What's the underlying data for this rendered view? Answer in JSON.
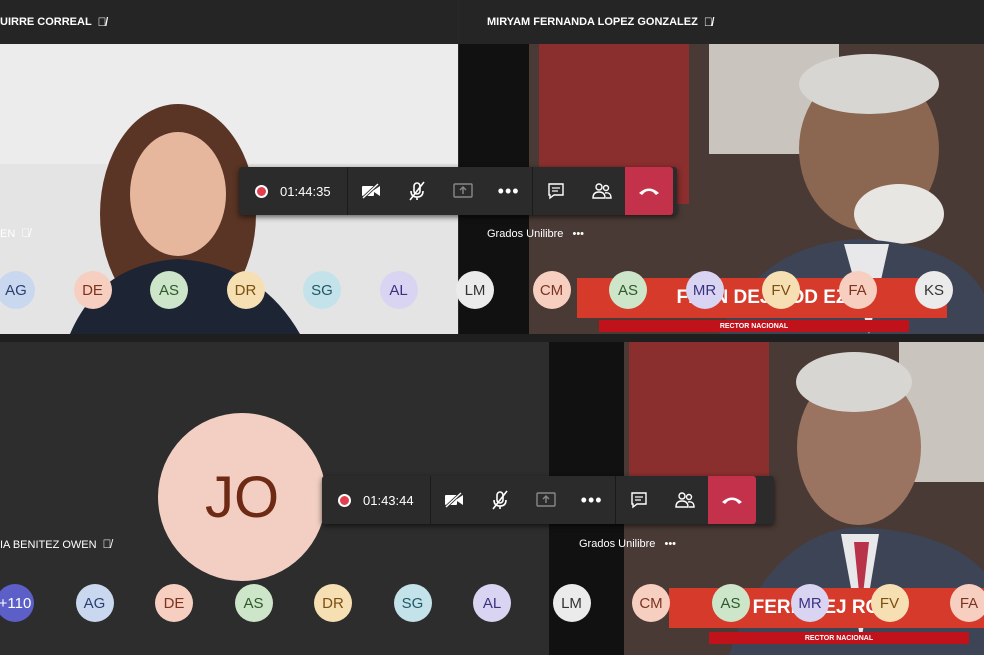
{
  "top": {
    "left_name": "UIRRE CORREAL",
    "right_name": "MIRYAM FERNANDA LOPEZ GONZALEZ",
    "partial_name": "EN",
    "stream_label": "Grados Unilibre",
    "stream_dots": "•••",
    "timer": "01:44:35",
    "banner_text": "FERN DEJ ROD EZ",
    "banner_sub": "RECTOR NACIONAL",
    "avatars": [
      {
        "initials": "AG",
        "color": "c1"
      },
      {
        "initials": "DE",
        "color": "c2"
      },
      {
        "initials": "AS",
        "color": "c3"
      },
      {
        "initials": "DR",
        "color": "c4"
      },
      {
        "initials": "SG",
        "color": "c5"
      },
      {
        "initials": "AL",
        "color": "c6"
      },
      {
        "initials": "LM",
        "color": "c7"
      },
      {
        "initials": "CM",
        "color": "c2"
      },
      {
        "initials": "AS",
        "color": "c3"
      },
      {
        "initials": "MR",
        "color": "c6"
      },
      {
        "initials": "FV",
        "color": "c4"
      },
      {
        "initials": "FA",
        "color": "c2"
      },
      {
        "initials": "KS",
        "color": "c7"
      }
    ]
  },
  "bottom": {
    "left_name": "IA BENITEZ OWEN",
    "jo_initials": "JO",
    "stream_label": "Grados Unilibre",
    "stream_dots": "•••",
    "timer": "01:43:44",
    "banner_text": "FERN DEJ ROOI",
    "banner_sub": "RECTOR NACIONAL",
    "avatars": [
      {
        "initials": "+110",
        "color": "cplus"
      },
      {
        "initials": "AG",
        "color": "c1"
      },
      {
        "initials": "DE",
        "color": "c2"
      },
      {
        "initials": "AS",
        "color": "c3"
      },
      {
        "initials": "DR",
        "color": "c4"
      },
      {
        "initials": "SG",
        "color": "c5"
      },
      {
        "initials": "AL",
        "color": "c6"
      },
      {
        "initials": "LM",
        "color": "c7"
      },
      {
        "initials": "CM",
        "color": "c2"
      },
      {
        "initials": "AS",
        "color": "c3"
      },
      {
        "initials": "MR",
        "color": "c6"
      },
      {
        "initials": "FV",
        "color": "c4"
      },
      {
        "initials": "FA",
        "color": "c2"
      }
    ]
  },
  "icons": {
    "mic_off": "mic-off-icon",
    "camera_off": "camera-off-icon",
    "share": "share-screen-icon",
    "more": "more-options-icon",
    "chat": "chat-icon",
    "participants": "participants-icon",
    "hangup": "hang-up-icon"
  },
  "colors": {
    "hangup": "#c4314b",
    "record": "#e04050",
    "toolbar": "#2b2b2b"
  }
}
